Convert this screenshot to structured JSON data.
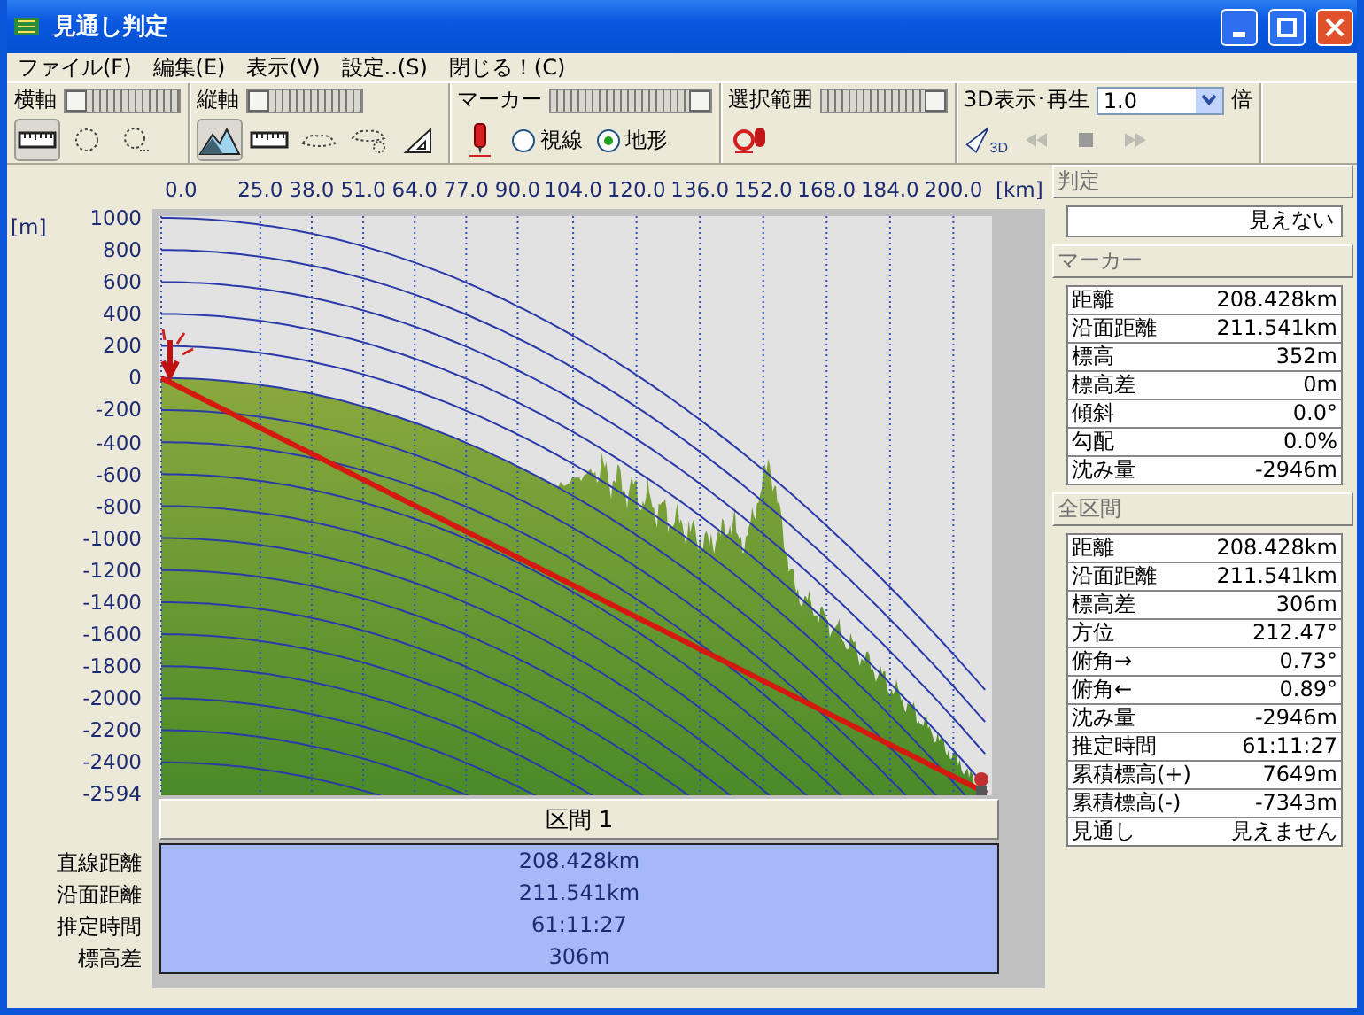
{
  "window": {
    "title": "見通し判定"
  },
  "menu": [
    {
      "label": "ファイル(F)"
    },
    {
      "label": "編集(E)"
    },
    {
      "label": "表示(V)"
    },
    {
      "label": "設定..(S)"
    },
    {
      "label": "閉じる！(C)"
    }
  ],
  "toolbar": [
    {
      "label": "横軸",
      "slider": {
        "level": 0
      },
      "tools": [
        {
          "kind": "button",
          "pressed": true
        },
        {
          "kind": "button",
          "pressed": false
        },
        {
          "kind": "button",
          "pressed": false
        }
      ]
    },
    {
      "label": "縦軸",
      "slider": {
        "level": 0
      },
      "tools": [
        {
          "kind": "button",
          "pressed": true
        },
        {
          "kind": "button",
          "pressed": false
        },
        {
          "kind": "button",
          "pressed": false
        },
        {
          "kind": "button",
          "pressed": false
        },
        {
          "kind": "button",
          "pressed": false
        }
      ]
    },
    {
      "label": "マーカー",
      "slider": {
        "level": 1
      },
      "tools": [
        {
          "kind": "button",
          "pressed": false
        },
        {
          "kind": "radio",
          "label": "視線",
          "selected": false
        },
        {
          "kind": "radio",
          "label": "地形",
          "selected": true
        }
      ]
    },
    {
      "label": "選択範囲",
      "slider": {
        "level": 1
      },
      "tools": [
        {
          "kind": "button",
          "pressed": false
        }
      ]
    },
    {
      "label": "3D表示･再生",
      "select": {
        "value": "1.0",
        "suffix": "倍"
      },
      "tools": [
        {
          "kind": "button",
          "pressed": false,
          "disabled": false,
          "caption": "3D"
        },
        {
          "kind": "button",
          "pressed": false,
          "disabled": true
        },
        {
          "kind": "button",
          "pressed": false,
          "disabled": false
        },
        {
          "kind": "button",
          "pressed": false,
          "disabled": true
        }
      ]
    }
  ],
  "chart": {
    "x_unit": "[km]",
    "y_unit": "[m]",
    "x_ticks": [
      "0.0",
      "25.0",
      "38.0",
      "51.0",
      "64.0",
      "77.0",
      "90.0",
      "104.0",
      "120.0",
      "136.0",
      "152.0",
      "168.0",
      "184.0",
      "200.0"
    ],
    "y_ticks": [
      "1000",
      "800",
      "600",
      "400",
      "200",
      "0",
      "-200",
      "-400",
      "-600",
      "-800",
      "-1000",
      "-1200",
      "-1400",
      "-1600",
      "-1800",
      "-2000",
      "-2200",
      "-2400",
      "-2594"
    ]
  },
  "section": {
    "title": "区間 1",
    "rows": [
      {
        "label": "直線距離",
        "value": "208.428km"
      },
      {
        "label": "沿面距離",
        "value": "211.541km"
      },
      {
        "label": "推定時間",
        "value": "61:11:27"
      },
      {
        "label": "標高差",
        "value": "306m"
      }
    ]
  },
  "side": {
    "verdict": {
      "title": "判定",
      "value": "見えない"
    },
    "groups": [
      {
        "title": "マーカー",
        "rows": [
          {
            "label": "距離",
            "value": "208.428km"
          },
          {
            "label": "沿面距離",
            "value": "211.541km"
          },
          {
            "label": "標高",
            "value": "352m"
          },
          {
            "label": "標高差",
            "value": "0m"
          },
          {
            "label": "傾斜",
            "value": "0.0°"
          },
          {
            "label": "勾配",
            "value": "0.0%"
          },
          {
            "label": "沈み量",
            "value": "-2946m"
          }
        ]
      },
      {
        "title": "全区間",
        "rows": [
          {
            "label": "距離",
            "value": "208.428km"
          },
          {
            "label": "沿面距離",
            "value": "211.541km"
          },
          {
            "label": "標高差",
            "value": "306m"
          },
          {
            "label": "方位",
            "value": "212.47°"
          },
          {
            "label": "俯角→",
            "value": "0.73°"
          },
          {
            "label": "俯角←",
            "value": "0.89°"
          },
          {
            "label": "沈み量",
            "value": "-2946m"
          },
          {
            "label": "推定時間",
            "value": "61:11:27"
          },
          {
            "label": "累積標高(+)",
            "value": "7649m"
          },
          {
            "label": "累積標高(-)",
            "value": "-7343m"
          },
          {
            "label": "見通し",
            "value": "見えません"
          }
        ]
      }
    ]
  }
}
